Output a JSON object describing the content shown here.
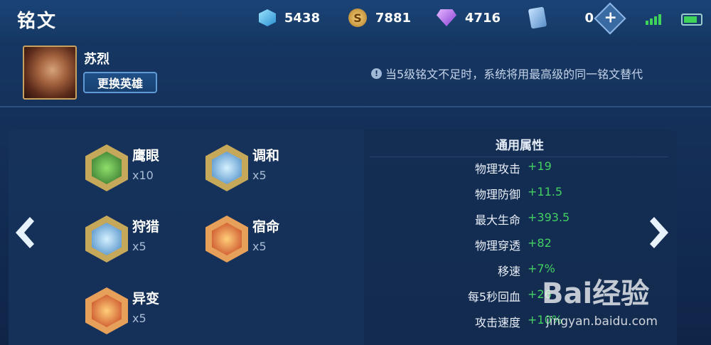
{
  "header": {
    "title": "铭文",
    "resources": [
      {
        "icon": "blue-crystal-icon",
        "value": "5438"
      },
      {
        "icon": "gold-coin-icon",
        "value": "7881"
      },
      {
        "icon": "purple-diamond-icon",
        "value": "4716"
      },
      {
        "icon": "ticket-card-icon",
        "value": "0"
      }
    ],
    "add_label": "+",
    "coin_symbol": "S"
  },
  "hero": {
    "name": "苏烈",
    "change_button": "更换英雄",
    "notice": "当5级铭文不足时，系统将用最高级的同一铭文替代",
    "info_glyph": "!"
  },
  "runes": [
    {
      "name": "鹰眼",
      "count": "x10",
      "color": "green"
    },
    {
      "name": "调和",
      "count": "x5",
      "color": "blue"
    },
    {
      "name": "狩猎",
      "count": "x5",
      "color": "blue"
    },
    {
      "name": "宿命",
      "count": "x5",
      "color": "red"
    },
    {
      "name": "异变",
      "count": "x5",
      "color": "red"
    }
  ],
  "attributes": {
    "title": "通用属性",
    "items": [
      {
        "label": "物理攻击",
        "value": "+19"
      },
      {
        "label": "物理防御",
        "value": "+11.5"
      },
      {
        "label": "最大生命",
        "value": "+393.5"
      },
      {
        "label": "物理穿透",
        "value": "+82"
      },
      {
        "label": "移速",
        "value": "+7%"
      },
      {
        "label": "每5秒回血",
        "value": "+26"
      },
      {
        "label": "攻击速度",
        "value": "+10%"
      }
    ]
  },
  "watermark": {
    "brand": "Bai经验",
    "url": "jingyan.baidu.com"
  },
  "colors": {
    "positive": "#43d063",
    "accent": "#5f9ad6"
  }
}
